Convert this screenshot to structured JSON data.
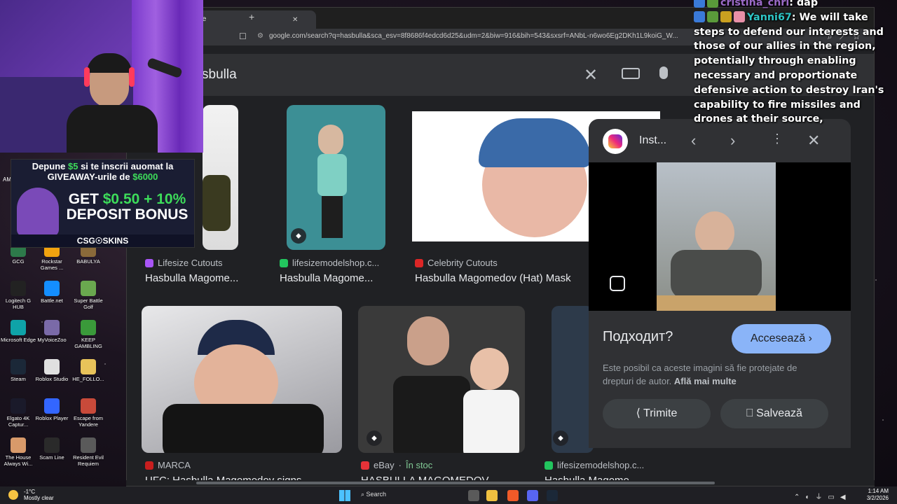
{
  "desktop": {
    "icons": [
      {
        "label": "GCG",
        "color": "#2d7a4a"
      },
      {
        "label": "Rockstar Games ...",
        "color": "#f2a30f"
      },
      {
        "label": "BABULYA",
        "color": "#8a6a3a"
      },
      {
        "label": "Logitech G HUB",
        "color": "#222222"
      },
      {
        "label": "Battle.net",
        "color": "#148eff"
      },
      {
        "label": "Super Battle Golf",
        "color": "#6aa84f"
      },
      {
        "label": "Microsoft Edge",
        "color": "#0fa3a8"
      },
      {
        "label": "MyVoiceZoo",
        "color": "#7a6aa8"
      },
      {
        "label": "KEEP GAMBLING",
        "color": "#3a9a3a"
      },
      {
        "label": "Steam",
        "color": "#1b2838"
      },
      {
        "label": "Roblox Studio",
        "color": "#e0e0e0"
      },
      {
        "label": "HE_FOLLO...",
        "color": "#e8c35a"
      },
      {
        "label": "Elgato 4K Captur...",
        "color": "#1a1a2a"
      },
      {
        "label": "Roblox Player",
        "color": "#3366ff"
      },
      {
        "label": "Escape from Yandere",
        "color": "#c84a3a"
      },
      {
        "label": "The House Always Wi...",
        "color": "#d89a6a"
      },
      {
        "label": "Scam Line",
        "color": "#2a2a2a"
      },
      {
        "label": "Resident Evil Requiem",
        "color": "#5a5a5a"
      }
    ],
    "am_label": "AM"
  },
  "browser": {
    "tab_label": "gle",
    "url": "google.com/search?q=hasbulla&sca_esv=8f8686f4edcd6d25&udm=2&biw=916&bih=543&sxsrf=ANbL-n6wo6Eg2DKh1L9koiG_W...",
    "query": "sbulla"
  },
  "results": [
    {
      "source": "Lifesize Cutouts",
      "title": "Hasbulla Magome...",
      "fav_color": "#a855f7"
    },
    {
      "source": "lifesizemodelshop.c...",
      "title": "Hasbulla Magome...",
      "fav_color": "#22c55e"
    },
    {
      "source": "Celebrity Cutouts",
      "title": "Hasbulla Magomedov (Hat) Mask",
      "fav_color": "#dc2626"
    },
    {
      "source": "MARCA",
      "title": "UFC: Hasbulla Magomedov signs ...",
      "fav_color": "#c81e1e"
    },
    {
      "source": "eBay",
      "stock": "În stoc",
      "title": "HASBULLA MAGOMEDOV ...",
      "fav_color": "#e53238"
    },
    {
      "source": "lifesizemodelshop.c...",
      "title": "Hasbulla Magome...",
      "fav_color": "#22c55e"
    }
  ],
  "panel": {
    "site": "Inst...",
    "fits_label": "Подходит?",
    "visit_label": "Accesează",
    "copyright_text": "Este posibil ca aceste imagini să fie protejate de drepturi de autor.",
    "learn_more": "Află mai multe",
    "share_label": "Trimite",
    "save_label": "Salvează"
  },
  "ad": {
    "line1_a": "Depune",
    "line1_amount": "$5",
    "line1_b": "si te inscrii auomat la",
    "line2_a": "GIVEAWAY-urile de",
    "line2_amount": "$6000",
    "bonus_a": "GET",
    "bonus_amount": "$0.50 + 10%",
    "bonus_b": "DEPOSIT BONUS",
    "brand": "CSG☉SKINS"
  },
  "chat": [
    {
      "user": "cristina_chri",
      "message": "dap"
    },
    {
      "user": "Yanni67",
      "message": "We will take steps to defend our interests and those of our allies in the region, potentially through enabling necessary and proportionate defensive action to destroy Iran's capability to fire missiles and drones at their source,"
    }
  ],
  "taskbar": {
    "temp": "-1°C",
    "weather": "Mostly clear",
    "search_label": "Search",
    "time": "1:14 AM",
    "date": "3/2/2026"
  }
}
